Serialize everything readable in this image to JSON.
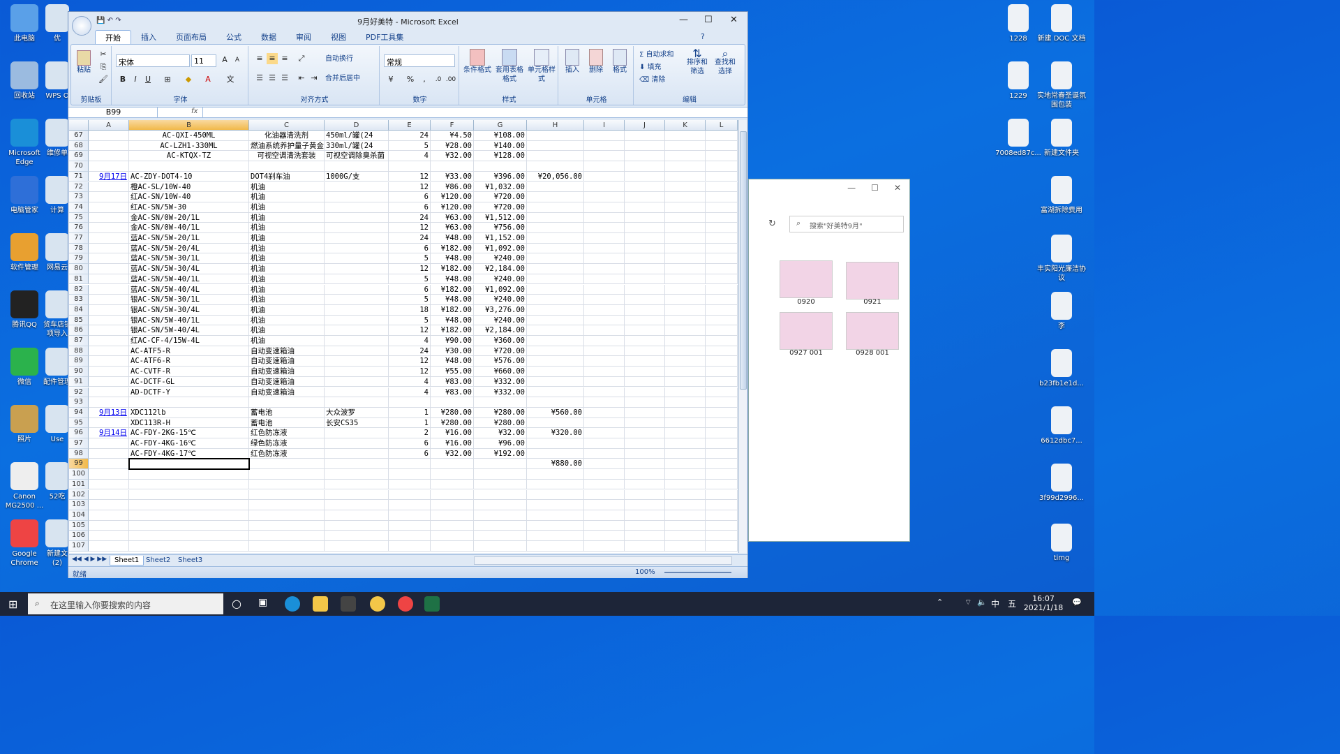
{
  "desktop": {
    "left_icons": [
      "此电脑",
      "回收站",
      "Microsoft Edge",
      "电脑管家",
      "软件管理",
      "腾讯QQ",
      "微信",
      "照片",
      "Canon MG2500 ...",
      "Google Chrome"
    ],
    "second_col": [
      "优",
      "WPS O",
      "维修单",
      "计算",
      "网易云",
      "货车店铺项导入",
      "配件管理",
      "Use",
      "52吃",
      "新建文(2)"
    ],
    "right_icons": [
      "1228",
      "新建 DOC 文档",
      "1229",
      "实地常春圣诞氛围包装",
      "7008ed87c...",
      "新建文件夹",
      "富湖拆除费用",
      "丰实阳光廉洁协议",
      "李",
      "b23fb1e1d...",
      "6612dbc7...",
      "3f99d2996...",
      "timg"
    ]
  },
  "explorer": {
    "search_placeholder": "搜索\"好美特9月\"",
    "thumbs": [
      "0920",
      "0921",
      "0927 001",
      "0928 001"
    ]
  },
  "excel": {
    "title": "9月好美特 - Microsoft Excel",
    "tabs": [
      "开始",
      "插入",
      "页面布局",
      "公式",
      "数据",
      "审阅",
      "视图",
      "PDF工具集"
    ],
    "ribbon": {
      "clipboard": "剪贴板",
      "paste": "粘贴",
      "font_group": "字体",
      "font_name": "宋体",
      "font_size": "11",
      "align_group": "对齐方式",
      "wrap": "自动换行",
      "merge": "合并后居中",
      "number_group": "数字",
      "number_format": "常规",
      "styles_group": "样式",
      "cond": "条件格式",
      "table_fmt": "套用表格格式",
      "cell_style": "单元格样式",
      "cells_group": "单元格",
      "insert": "插入",
      "delete": "删除",
      "format": "格式",
      "edit_group": "编辑",
      "autosum": "自动求和",
      "fill": "填充",
      "clear": "清除",
      "sort": "排序和筛选",
      "find": "查找和选择"
    },
    "name_box": "B99",
    "fx": "fx",
    "columns": [
      "A",
      "B",
      "C",
      "D",
      "E",
      "F",
      "G",
      "H",
      "I",
      "J",
      "K",
      "L"
    ],
    "rows": [
      {
        "n": "67",
        "a": "",
        "b": "AC-QXI-450ML",
        "c": "化油器清洗剂",
        "d": "450ml/罐(24",
        "e": "24",
        "f": "¥4.50",
        "g": "¥108.00",
        "h": ""
      },
      {
        "n": "68",
        "a": "",
        "b": "AC-LZH1-330ML",
        "c": "燃油系统养护量子黄金",
        "d": "330ml/罐(24",
        "e": "5",
        "f": "¥28.00",
        "g": "¥140.00",
        "h": ""
      },
      {
        "n": "69",
        "a": "",
        "b": "AC-KTQX-TZ",
        "c": "可视空调清洗套装",
        "d": "可视空调除臭杀菌",
        "e": "4",
        "f": "¥32.00",
        "g": "¥128.00",
        "h": ""
      },
      {
        "n": "70",
        "a": "",
        "b": "",
        "c": "",
        "d": "",
        "e": "",
        "f": "",
        "g": "",
        "h": ""
      },
      {
        "n": "71",
        "a": "9月17日",
        "b": "AC-ZDY-DOT4-10",
        "c": "DOT4刹车油",
        "d": "1000G/支",
        "e": "12",
        "f": "¥33.00",
        "g": "¥396.00",
        "h": "¥20,056.00"
      },
      {
        "n": "72",
        "a": "",
        "b": "橙AC-SL/10W-40",
        "c": "机油",
        "d": "",
        "e": "12",
        "f": "¥86.00",
        "g": "¥1,032.00",
        "h": ""
      },
      {
        "n": "73",
        "a": "",
        "b": "红AC-SN/10W-40",
        "c": "机油",
        "d": "",
        "e": "6",
        "f": "¥120.00",
        "g": "¥720.00",
        "h": ""
      },
      {
        "n": "74",
        "a": "",
        "b": "红AC-SN/5W-30",
        "c": "机油",
        "d": "",
        "e": "6",
        "f": "¥120.00",
        "g": "¥720.00",
        "h": ""
      },
      {
        "n": "75",
        "a": "",
        "b": "金AC-SN/0W-20/1L",
        "c": "机油",
        "d": "",
        "e": "24",
        "f": "¥63.00",
        "g": "¥1,512.00",
        "h": ""
      },
      {
        "n": "76",
        "a": "",
        "b": "金AC-SN/0W-40/1L",
        "c": "机油",
        "d": "",
        "e": "12",
        "f": "¥63.00",
        "g": "¥756.00",
        "h": ""
      },
      {
        "n": "77",
        "a": "",
        "b": "蓝AC-SN/5W-20/1L",
        "c": "机油",
        "d": "",
        "e": "24",
        "f": "¥48.00",
        "g": "¥1,152.00",
        "h": ""
      },
      {
        "n": "78",
        "a": "",
        "b": "蓝AC-SN/5W-20/4L",
        "c": "机油",
        "d": "",
        "e": "6",
        "f": "¥182.00",
        "g": "¥1,092.00",
        "h": ""
      },
      {
        "n": "79",
        "a": "",
        "b": "蓝AC-SN/5W-30/1L",
        "c": "机油",
        "d": "",
        "e": "5",
        "f": "¥48.00",
        "g": "¥240.00",
        "h": ""
      },
      {
        "n": "80",
        "a": "",
        "b": "蓝AC-SN/5W-30/4L",
        "c": "机油",
        "d": "",
        "e": "12",
        "f": "¥182.00",
        "g": "¥2,184.00",
        "h": ""
      },
      {
        "n": "81",
        "a": "",
        "b": "蓝AC-SN/5W-40/1L",
        "c": "机油",
        "d": "",
        "e": "5",
        "f": "¥48.00",
        "g": "¥240.00",
        "h": ""
      },
      {
        "n": "82",
        "a": "",
        "b": "蓝AC-SN/5W-40/4L",
        "c": "机油",
        "d": "",
        "e": "6",
        "f": "¥182.00",
        "g": "¥1,092.00",
        "h": ""
      },
      {
        "n": "83",
        "a": "",
        "b": "银AC-SN/5W-30/1L",
        "c": "机油",
        "d": "",
        "e": "5",
        "f": "¥48.00",
        "g": "¥240.00",
        "h": ""
      },
      {
        "n": "84",
        "a": "",
        "b": "银AC-SN/5W-30/4L",
        "c": "机油",
        "d": "",
        "e": "18",
        "f": "¥182.00",
        "g": "¥3,276.00",
        "h": ""
      },
      {
        "n": "85",
        "a": "",
        "b": "银AC-SN/5W-40/1L",
        "c": "机油",
        "d": "",
        "e": "5",
        "f": "¥48.00",
        "g": "¥240.00",
        "h": ""
      },
      {
        "n": "86",
        "a": "",
        "b": "银AC-SN/5W-40/4L",
        "c": "机油",
        "d": "",
        "e": "12",
        "f": "¥182.00",
        "g": "¥2,184.00",
        "h": ""
      },
      {
        "n": "87",
        "a": "",
        "b": "红AC-CF-4/15W-4L",
        "c": "机油",
        "d": "",
        "e": "4",
        "f": "¥90.00",
        "g": "¥360.00",
        "h": ""
      },
      {
        "n": "88",
        "a": "",
        "b": "AC-ATF5-R",
        "c": "自动变速箱油",
        "d": "",
        "e": "24",
        "f": "¥30.00",
        "g": "¥720.00",
        "h": ""
      },
      {
        "n": "89",
        "a": "",
        "b": "AC-ATF6-R",
        "c": "自动变速箱油",
        "d": "",
        "e": "12",
        "f": "¥48.00",
        "g": "¥576.00",
        "h": ""
      },
      {
        "n": "90",
        "a": "",
        "b": "AC-CVTF-R",
        "c": "自动变速箱油",
        "d": "",
        "e": "12",
        "f": "¥55.00",
        "g": "¥660.00",
        "h": ""
      },
      {
        "n": "91",
        "a": "",
        "b": "AC-DCTF-GL",
        "c": "自动变速箱油",
        "d": "",
        "e": "4",
        "f": "¥83.00",
        "g": "¥332.00",
        "h": ""
      },
      {
        "n": "92",
        "a": "",
        "b": "AD-DCTF-Y",
        "c": "自动变速箱油",
        "d": "",
        "e": "4",
        "f": "¥83.00",
        "g": "¥332.00",
        "h": ""
      },
      {
        "n": "93",
        "a": "",
        "b": "",
        "c": "",
        "d": "",
        "e": "",
        "f": "",
        "g": "",
        "h": ""
      },
      {
        "n": "94",
        "a": "9月13日",
        "b": "XDC112lb",
        "c": "蓄电池",
        "d": "大众波罗",
        "e": "1",
        "f": "¥280.00",
        "g": "¥280.00",
        "h": "¥560.00"
      },
      {
        "n": "95",
        "a": "",
        "b": "XDC113R-H",
        "c": "蓄电池",
        "d": "长安CS35",
        "e": "1",
        "f": "¥280.00",
        "g": "¥280.00",
        "h": ""
      },
      {
        "n": "96",
        "a": "9月14日",
        "b": "AC-FDY-2KG-15℃",
        "c": "红色防冻液",
        "d": "",
        "e": "2",
        "f": "¥16.00",
        "g": "¥32.00",
        "h": "¥320.00"
      },
      {
        "n": "97",
        "a": "",
        "b": "AC-FDY-4KG-16℃",
        "c": "绿色防冻液",
        "d": "",
        "e": "6",
        "f": "¥16.00",
        "g": "¥96.00",
        "h": ""
      },
      {
        "n": "98",
        "a": "",
        "b": "AC-FDY-4KG-17℃",
        "c": "红色防冻液",
        "d": "",
        "e": "6",
        "f": "¥32.00",
        "g": "¥192.00",
        "h": ""
      },
      {
        "n": "99",
        "a": "",
        "b": "",
        "c": "",
        "d": "",
        "e": "",
        "f": "",
        "g": "",
        "h": "¥880.00"
      },
      {
        "n": "100",
        "a": "",
        "b": "",
        "c": "",
        "d": "",
        "e": "",
        "f": "",
        "g": "",
        "h": ""
      },
      {
        "n": "101",
        "a": "",
        "b": "",
        "c": "",
        "d": "",
        "e": "",
        "f": "",
        "g": "",
        "h": ""
      },
      {
        "n": "102",
        "a": "",
        "b": "",
        "c": "",
        "d": "",
        "e": "",
        "f": "",
        "g": "",
        "h": ""
      },
      {
        "n": "103",
        "a": "",
        "b": "",
        "c": "",
        "d": "",
        "e": "",
        "f": "",
        "g": "",
        "h": ""
      },
      {
        "n": "104",
        "a": "",
        "b": "",
        "c": "",
        "d": "",
        "e": "",
        "f": "",
        "g": "",
        "h": ""
      },
      {
        "n": "105",
        "a": "",
        "b": "",
        "c": "",
        "d": "",
        "e": "",
        "f": "",
        "g": "",
        "h": ""
      },
      {
        "n": "106",
        "a": "",
        "b": "",
        "c": "",
        "d": "",
        "e": "",
        "f": "",
        "g": "",
        "h": ""
      },
      {
        "n": "107",
        "a": "",
        "b": "",
        "c": "",
        "d": "",
        "e": "",
        "f": "",
        "g": "",
        "h": ""
      }
    ],
    "sheets": [
      "Sheet1",
      "Sheet2",
      "Sheet3"
    ],
    "status": "就绪",
    "zoom": "100%"
  },
  "taskbar": {
    "search_placeholder": "在这里输入你要搜索的内容",
    "time": "16:07",
    "date": "2021/1/18",
    "ime": "中",
    "ime2": "五"
  }
}
